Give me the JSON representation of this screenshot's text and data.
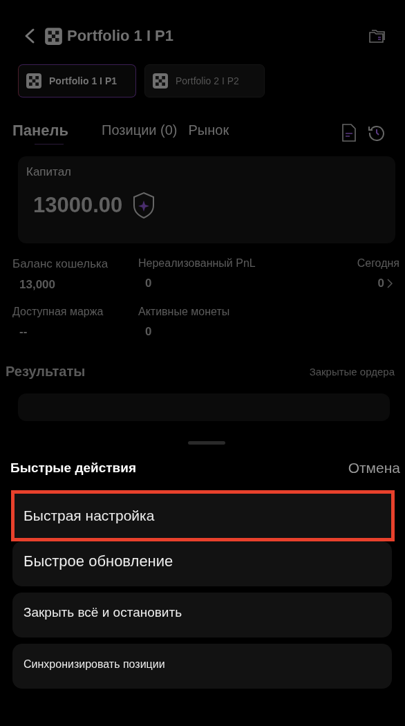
{
  "header": {
    "title": "Portfolio 1 I P1"
  },
  "portfolios": [
    {
      "label": "Portfolio 1 I P1",
      "selected": true
    },
    {
      "label": "Portfolio 2 I P2",
      "selected": false
    }
  ],
  "tabs": [
    {
      "label": "Панель",
      "selected": true
    },
    {
      "label": "Позиции (0)",
      "selected": false
    },
    {
      "label": "Рынок",
      "selected": false
    }
  ],
  "capital": {
    "label": "Капитал",
    "value": "13000.00"
  },
  "stats": [
    {
      "label": "Баланс кошелька",
      "value": "13,000"
    },
    {
      "label": "Нереализованный PnL",
      "value": "0"
    },
    {
      "label": "Сегодня",
      "value": "0",
      "link": true
    },
    {
      "label": "Доступная маржа",
      "value": "--"
    },
    {
      "label": "Активные монеты",
      "value": "0"
    }
  ],
  "results": {
    "title": "Результаты",
    "link": "Закрытые ордера"
  },
  "sheet": {
    "title": "Быстрые действия",
    "cancel": "Отмена",
    "actions": [
      {
        "label": "Быстрая настройка",
        "highlighted": true
      },
      {
        "label": "Быстрое обновление",
        "highlighted": false
      },
      {
        "label": "Закрыть всё и остановить",
        "highlighted": false
      },
      {
        "label": "Синхронизировать позиции",
        "highlighted": false
      }
    ]
  }
}
